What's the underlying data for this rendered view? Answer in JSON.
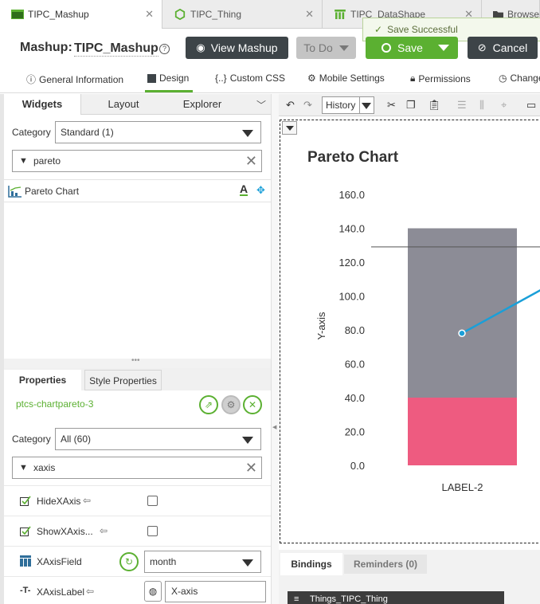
{
  "tabs": [
    {
      "label": "TIPC_Mashup",
      "icon": "mashup-icon",
      "active": true
    },
    {
      "label": "TIPC_Thing",
      "icon": "thing-icon",
      "active": false
    },
    {
      "label": "TIPC_DataShape",
      "icon": "datashape-icon",
      "active": false
    },
    {
      "label": "Browse",
      "icon": "folder-icon",
      "active": false
    }
  ],
  "header": {
    "entity_type": "Mashup:",
    "entity_name": "TIPC_Mashup",
    "view_button": "View Mashup",
    "todo_button": "To Do",
    "save_button": "Save",
    "cancel_button": "Cancel",
    "toast": "Save Successful"
  },
  "nav": [
    {
      "label": "General Information",
      "icon": "info-icon"
    },
    {
      "label": "Design",
      "icon": "design-icon",
      "active": true
    },
    {
      "label": "Custom CSS",
      "icon": "css-icon"
    },
    {
      "label": "Mobile Settings",
      "icon": "gear-icon"
    },
    {
      "label": "Permissions",
      "icon": "lock-icon"
    },
    {
      "label": "Change",
      "icon": "clock-icon"
    }
  ],
  "left_tabs": [
    "Widgets",
    "Layout",
    "Explorer"
  ],
  "widgets": {
    "category_label": "Category",
    "category_value": "Standard (1)",
    "search_value": "pareto",
    "items": [
      {
        "label": "Pareto Chart"
      }
    ]
  },
  "properties": {
    "tabs": [
      "Properties",
      "Style Properties"
    ],
    "widget_id": "ptcs-chartpareto-3",
    "category_label": "Category",
    "category_value": "All (60)",
    "search_value": "xaxis",
    "rows": [
      {
        "label": "HideXAxis",
        "type": "checkbox",
        "checked": false
      },
      {
        "label": "ShowXAxis...",
        "type": "checkbox",
        "checked": false
      },
      {
        "label": "XAxisField",
        "type": "select",
        "value": "month"
      },
      {
        "label": "XAxisLabel",
        "type": "text",
        "value": "X-axis"
      }
    ]
  },
  "canvas_toolbar": {
    "history_label": "History"
  },
  "chart_data": {
    "type": "bar",
    "title": "Pareto Chart",
    "ylabel": "Y-axis",
    "ylim": [
      0,
      160
    ],
    "yticks": [
      "0.0",
      "20.0",
      "40.0",
      "60.0",
      "80.0",
      "100.0",
      "120.0",
      "140.0",
      "160.0"
    ],
    "categories": [
      "LABEL-2"
    ],
    "series": [
      {
        "values": [
          100
        ],
        "color": "#8c8c96"
      },
      {
        "values": [
          40
        ],
        "color": "#ee5b80"
      }
    ],
    "line_values": [
      78
    ],
    "line_color": "#1a9fd8",
    "reference_line": 129
  },
  "bindings": {
    "tabs": [
      "Bindings",
      "Reminders (0)"
    ],
    "thing_label": "Things_TIPC_Thing"
  },
  "colors": {
    "accent": "#5bb031",
    "dark_button": "#3d4448",
    "todo": "#bdbdbd"
  }
}
